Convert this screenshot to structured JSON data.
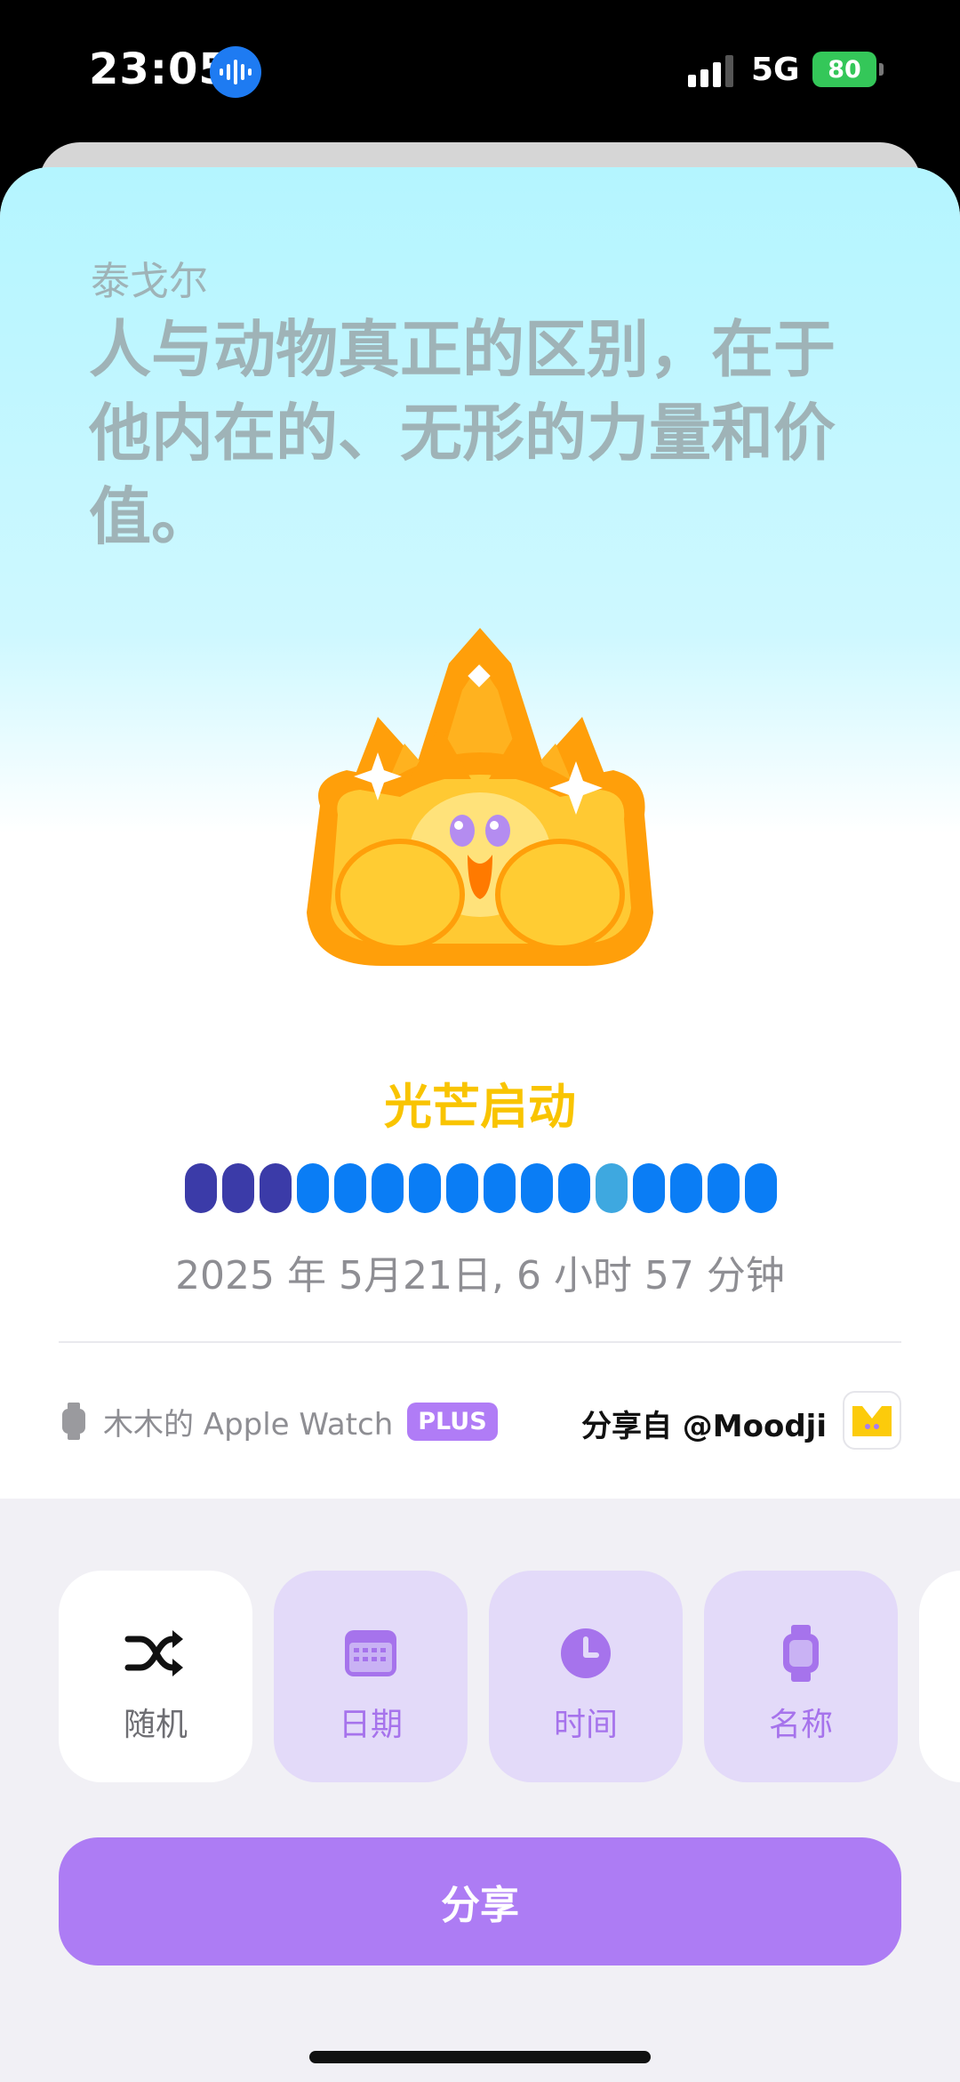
{
  "status_bar": {
    "time": "23:05",
    "network": "5G",
    "battery": "80"
  },
  "quote": {
    "author": "泰戈尔",
    "text": "人与动物真正的区别，在于他内在的、无形的力量和价值。"
  },
  "mood": {
    "label": "光芒启动",
    "pill_colors": [
      "#3b3ba8",
      "#3b3ba8",
      "#3b3ba8",
      "#0a7df5",
      "#0a7df5",
      "#0a7df5",
      "#0a7df5",
      "#0a7df5",
      "#0a7df5",
      "#0a7df5",
      "#0a7df5",
      "#3ea8e0",
      "#0a7df5",
      "#0a7df5",
      "#0a7df5",
      "#0a7df5"
    ]
  },
  "date_line": "2025 年 5月21日, 6 小时 57 分钟",
  "device": {
    "name": "木木的 Apple Watch",
    "badge": "PLUS"
  },
  "share_from": "分享自 @Moodji",
  "options": [
    {
      "label": "随机",
      "icon": "shuffle-icon",
      "active": true
    },
    {
      "label": "日期",
      "icon": "calendar-icon",
      "active": false
    },
    {
      "label": "时间",
      "icon": "clock-icon",
      "active": false
    },
    {
      "label": "名称",
      "icon": "watch-icon",
      "active": false
    }
  ],
  "share_button": "分享",
  "colors": {
    "accent": "#ad7cf4",
    "mood_label": "#f9c400",
    "option_bg": "#e3daf9"
  }
}
